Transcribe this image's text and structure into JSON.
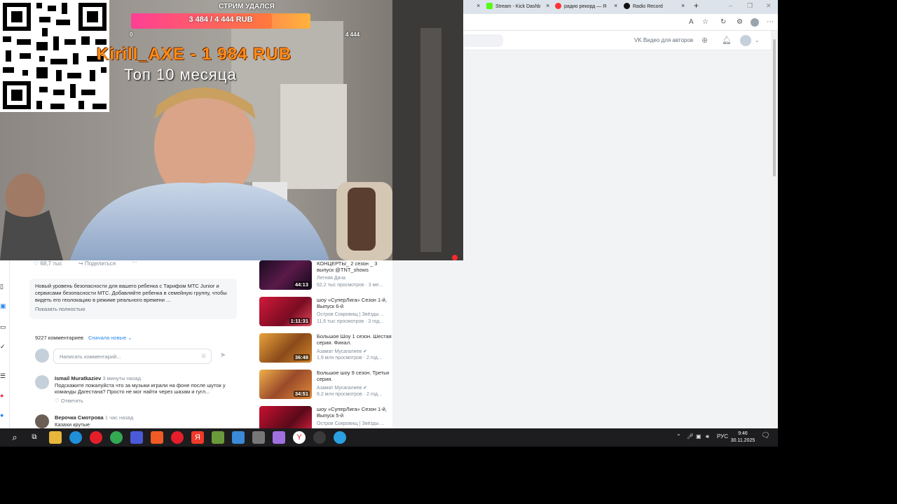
{
  "browser": {
    "tabs": [
      {
        "label": "Stream - Kick Dashb",
        "color": "#53fc18"
      },
      {
        "label": "радио рекорд — Я",
        "color": "#ff3333"
      },
      {
        "label": "Radio Record",
        "color": "#111111"
      }
    ],
    "new_tab_label": "+",
    "close_glyph": "×"
  },
  "vk_header": {
    "authors_link": "VK Видео для авторов",
    "icons": [
      "add-icon",
      "bell-icon",
      "avatar-icon"
    ]
  },
  "stream_overlay": {
    "goal_title": "СТРИМ УДАЛСЯ",
    "goal_progress": "3 484 / 4 444 RUB",
    "goal_fraction": 0.784,
    "goal_min": "0",
    "goal_max": "4 444",
    "top_donor": "Kirill_AXE - 1 984 RUB",
    "top_period": "Топ 10 месяца"
  },
  "post": {
    "likes": "68,7 тыс",
    "share_label": "Поделиться",
    "more_label": "···",
    "description": "Новый уровень безопасности для вашего ребенка с Тарифом МТС Junior и сервисами безопасности МТС. Добавляйте ребенка в семейную группу, чтобы видеть его геолокацию в режиме реального времени ...",
    "show_more": "Показать полностью"
  },
  "comments": {
    "count": "9227 комментариев",
    "sort": "Сначала новые",
    "input_placeholder": "Написать комментарий...",
    "items": [
      {
        "author": "Ismail Muratkaziev",
        "time": "3 минуты назад",
        "text": "Подскажите пожалуйста что за музыки играли на фоне после шуток у команды Дагестана? Просто не мог найти через шазам и гугл...",
        "reply": "Ответить"
      },
      {
        "author": "Верочка Смотрова",
        "time": "1 час назад",
        "text": "Казахи крутые",
        "reply": "Ответить"
      }
    ]
  },
  "recommendations": [
    {
      "title": "КОНЦЕРТЫ_ 2 сезон _ 3 выпуск @TNT_shows",
      "channel": "Летняя Дача",
      "views": "62,2 тыс просмотров · 3 ме...",
      "duration": "44:13",
      "thumb": "#3a1238"
    },
    {
      "title": "шоу «СуперЛига» Сезон 1-й, Выпуск 6-й",
      "channel": "Остров Сокровищ | Звёзды ...",
      "views": "11,6 тыс просмотров · 3 год...",
      "duration": "1:11:31",
      "thumb": "#b01030"
    },
    {
      "title": "Большое Шоу 1 сезон. Шестая серия. Финал.",
      "channel": "Азамат Мусагалиев ✔",
      "views": "1,9 млн просмотров · 2 год...",
      "duration": "36:48",
      "thumb": "#c8721c"
    },
    {
      "title": "Большое шоу 9 сезон. Третья серия.",
      "channel": "Азамат Мусагалиев ✔",
      "views": "8,2 млн просмотров · 2 год...",
      "duration": "34:51",
      "thumb": "#c9702e"
    },
    {
      "title": "шоу «СуперЛига» Сезон 1-й, Выпуск 5-й",
      "channel": "Остров Сокровищ | Звёзды ...",
      "views": "",
      "duration": "",
      "thumb": "#a0102a"
    }
  ],
  "taskbar": {
    "apps": [
      "search-icon",
      "task-view-icon",
      "file-explorer-icon",
      "edge-icon",
      "opera-gx-icon",
      "chrome-icon",
      "app-icon",
      "brave-icon",
      "opera-icon",
      "yandex-icon",
      "minecraft-icon",
      "app-icon",
      "obs-icon",
      "app-icon",
      "yandex-browser-icon",
      "obs-studio-icon",
      "telegram-icon"
    ],
    "language": "РУС",
    "time": "9:46",
    "date": "30.11.2025"
  }
}
